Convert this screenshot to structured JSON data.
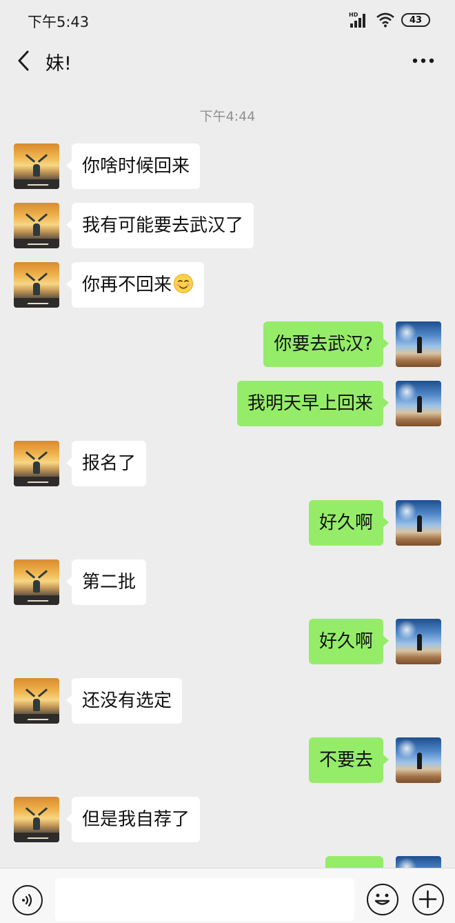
{
  "status_bar": {
    "time": "下午5:43",
    "network_badge": "HD",
    "battery": "43",
    "icons": [
      "signal-icon",
      "wifi-icon",
      "battery-icon"
    ]
  },
  "nav": {
    "title": "妹!",
    "back_icon": "chevron-left-icon",
    "more_icon": "more-dots-icon"
  },
  "chat": {
    "timestamp": "下午4:44",
    "messages": [
      {
        "side": "left",
        "text": "你啥时候回来",
        "avatar": "sunset-road-avatar"
      },
      {
        "side": "left",
        "text": "我有可能要去武汉了",
        "avatar": "sunset-road-avatar"
      },
      {
        "side": "left",
        "text": "你再不回来",
        "emoji": "smile-emoji",
        "avatar": "sunset-road-avatar"
      },
      {
        "side": "right",
        "text": "你要去武汉?",
        "avatar": "blue-sky-avatar"
      },
      {
        "side": "right",
        "text": "我明天早上回来",
        "avatar": "blue-sky-avatar"
      },
      {
        "side": "left",
        "text": "报名了",
        "avatar": "sunset-road-avatar"
      },
      {
        "side": "right",
        "text": "好久啊",
        "avatar": "blue-sky-avatar"
      },
      {
        "side": "left",
        "text": "第二批",
        "avatar": "sunset-road-avatar"
      },
      {
        "side": "right",
        "text": "好久啊",
        "avatar": "blue-sky-avatar"
      },
      {
        "side": "left",
        "text": "还没有选定",
        "avatar": "sunset-road-avatar"
      },
      {
        "side": "right",
        "text": "不要去",
        "avatar": "blue-sky-avatar"
      },
      {
        "side": "left",
        "text": "但是我自荐了",
        "avatar": "sunset-road-avatar"
      },
      {
        "side": "right",
        "text": "",
        "avatar": "blue-sky-avatar"
      }
    ]
  },
  "input_bar": {
    "voice_icon": "voice-icon",
    "input_value": "",
    "emoji_icon": "emoji-icon",
    "plus_icon": "plus-icon"
  },
  "colors": {
    "background": "#ededed",
    "incoming_bubble": "#ffffff",
    "outgoing_bubble": "#95ec69"
  }
}
